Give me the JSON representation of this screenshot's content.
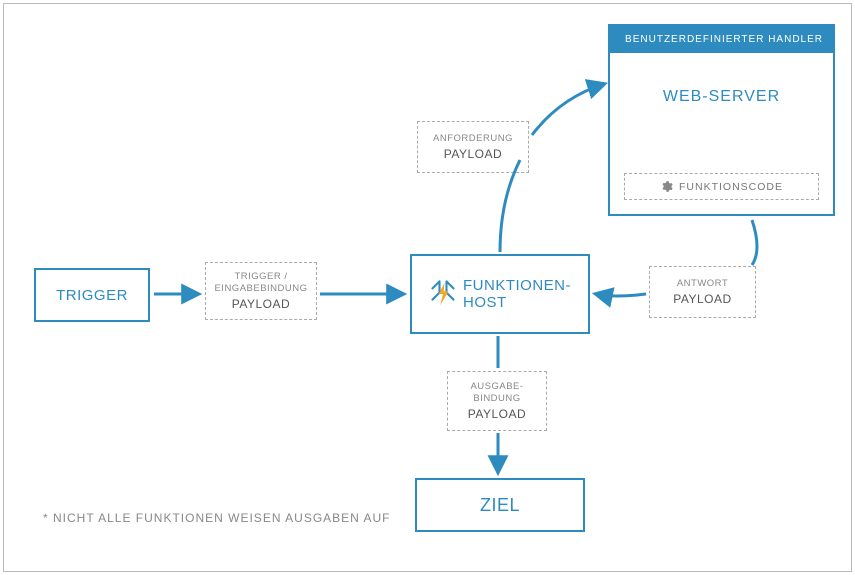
{
  "frame": {
    "footnote": "*  NICHT ALLE FUNKTIONEN WEISEN AUSGABEN AUF"
  },
  "trigger": {
    "label": "TRIGGER"
  },
  "trigger_payload": {
    "top": "TRIGGER /",
    "mid": "EINGABEBINDUNG",
    "payload": "PAYLOAD"
  },
  "host": {
    "line1": "FUNKTIONEN-",
    "line2": "HOST"
  },
  "request_payload": {
    "top": "ANFORDERUNG",
    "payload": "PAYLOAD"
  },
  "response_payload": {
    "top": "ANTWORT",
    "payload": "PAYLOAD"
  },
  "output_payload": {
    "top1": "AUSGABE-",
    "top2": "BINDUNG",
    "payload": "PAYLOAD"
  },
  "target": {
    "label": "ZIEL"
  },
  "handler": {
    "header": "BENUTZERDEFINIERTER  HANDLER",
    "webserver": "WEB-SERVER",
    "funccode": "FUNKTIONSCODE"
  },
  "colors": {
    "accent": "#2e8bc0"
  }
}
